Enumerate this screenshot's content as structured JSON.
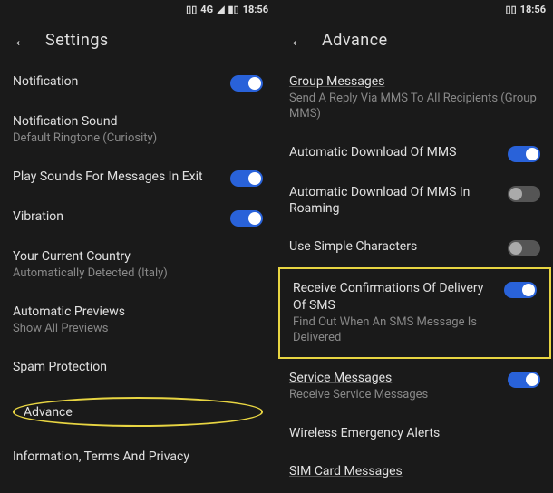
{
  "status": {
    "time": "18:56",
    "net": "4G"
  },
  "left": {
    "title": "Settings",
    "items": {
      "notification": {
        "title": "Notification"
      },
      "notif_sound": {
        "title": "Notification Sound",
        "subtitle": "Default Ringtone (Curiosity)"
      },
      "play_sounds": {
        "title": "Play Sounds For Messages In Exit"
      },
      "vibration": {
        "title": "Vibration"
      },
      "country": {
        "title": "Your Current Country",
        "subtitle": "Automatically Detected (Italy)"
      },
      "previews": {
        "title": "Automatic Previews",
        "subtitle": "Show All Previews"
      },
      "spam": {
        "title": "Spam Protection"
      },
      "advance": {
        "title": "Advance"
      },
      "info": {
        "title": "Information, Terms And Privacy"
      }
    }
  },
  "right": {
    "title": "Advance",
    "items": {
      "group": {
        "title": "Group Messages",
        "subtitle": "Send A Reply Via MMS To All Recipients (Group MMS)"
      },
      "auto_mms": {
        "title": "Automatic Download Of MMS"
      },
      "auto_mms_roam": {
        "title": "Automatic Download Of MMS In Roaming"
      },
      "simple_chars": {
        "title": "Use Simple Characters"
      },
      "delivery_conf": {
        "title": "Receive Confirmations Of Delivery Of SMS",
        "subtitle": "Find Out When An SMS Message Is Delivered"
      },
      "service_msg": {
        "title": "Service Messages",
        "subtitle": "Receive Service Messages"
      },
      "wea": {
        "title": "Wireless Emergency Alerts"
      },
      "sim": {
        "title": "SIM Card Messages"
      }
    }
  }
}
